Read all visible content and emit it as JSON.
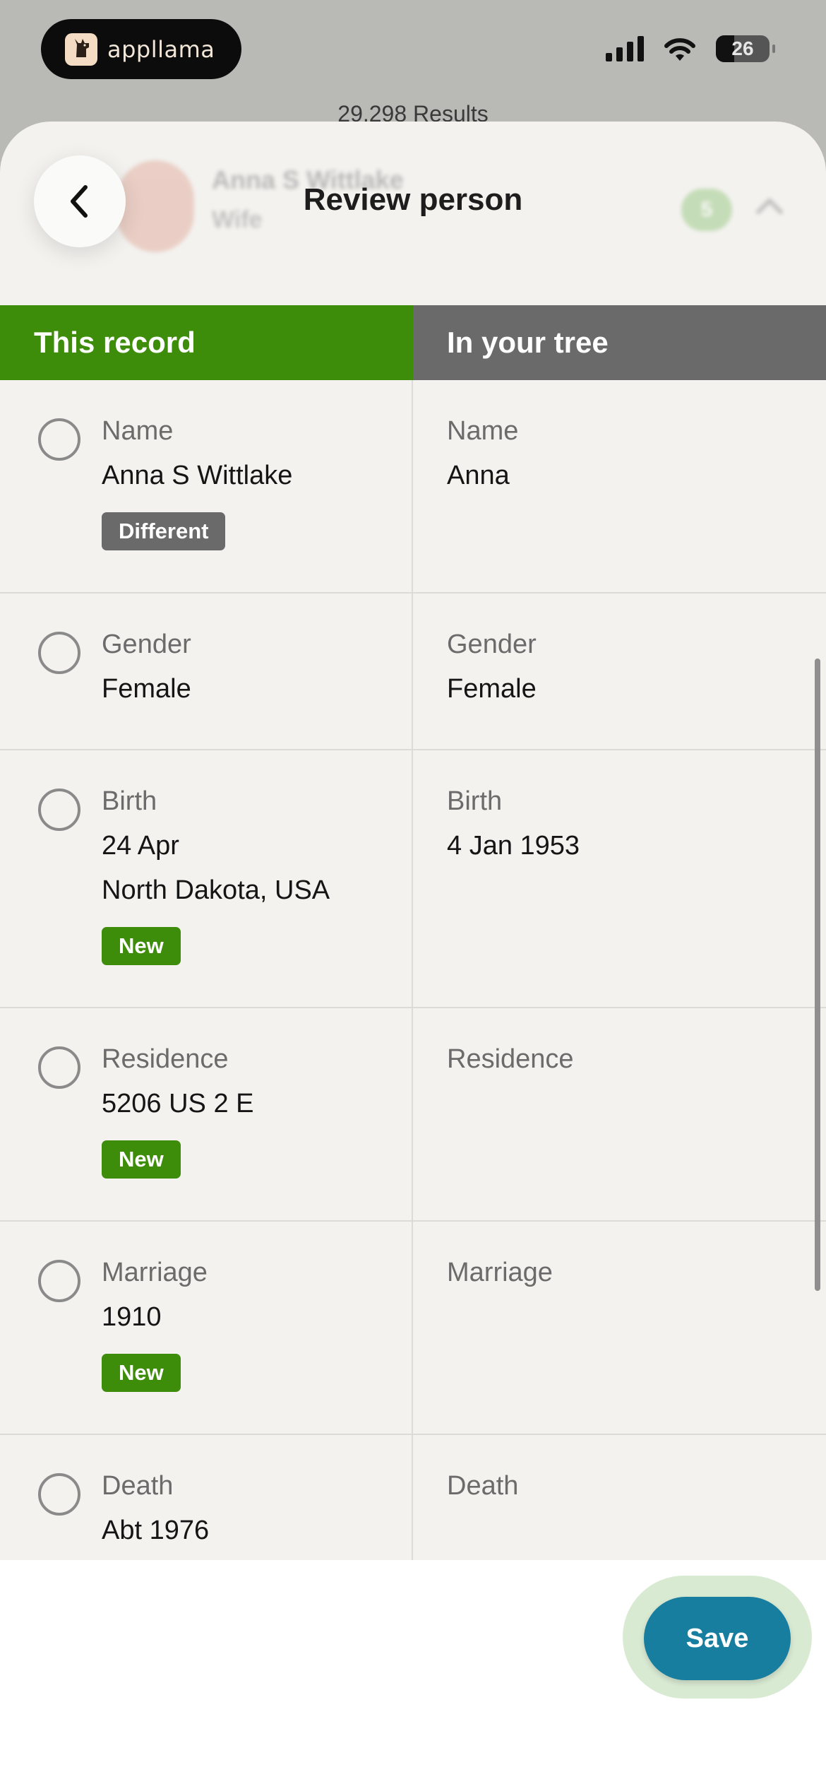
{
  "status_bar": {
    "app_brand": "appllama",
    "battery_level": "26",
    "icons": [
      "llama-logo-icon",
      "signal-icon",
      "wifi-icon",
      "battery-icon"
    ]
  },
  "background": {
    "results_text": "29,298 Results"
  },
  "header": {
    "title": "Review person",
    "back_icon": "chevron-left-icon",
    "blurred_person_name": "Anna S Wittlake",
    "blurred_person_relation": "Wife",
    "blurred_badge": "5"
  },
  "table": {
    "left_header": "This record",
    "right_header": "In your tree",
    "rows": [
      {
        "label": "Name",
        "record_values": [
          "Anna S Wittlake"
        ],
        "badge": "Different",
        "tree_values": [
          "Anna"
        ]
      },
      {
        "label": "Gender",
        "record_values": [
          "Female"
        ],
        "badge": "",
        "tree_values": [
          "Female"
        ]
      },
      {
        "label": "Birth",
        "record_values": [
          "24 Apr",
          "North Dakota, USA"
        ],
        "badge": "New",
        "tree_values": [
          "4 Jan 1953"
        ]
      },
      {
        "label": "Residence",
        "record_values": [
          "5206 US 2 E"
        ],
        "badge": "New",
        "tree_values": []
      },
      {
        "label": "Marriage",
        "record_values": [
          "1910"
        ],
        "badge": "New",
        "tree_values": []
      },
      {
        "label": "Death",
        "record_values": [
          "Abt 1976"
        ],
        "badge": "",
        "tree_values": []
      }
    ]
  },
  "footer": {
    "save_label": "Save"
  },
  "colors": {
    "record_header": "#3d8c0a",
    "tree_header": "#6a6a6a",
    "badge_new": "#3d8c0a",
    "badge_different": "#6a6a6a",
    "save_button": "#187ea0",
    "sheet_background": "#f3f2ef"
  }
}
